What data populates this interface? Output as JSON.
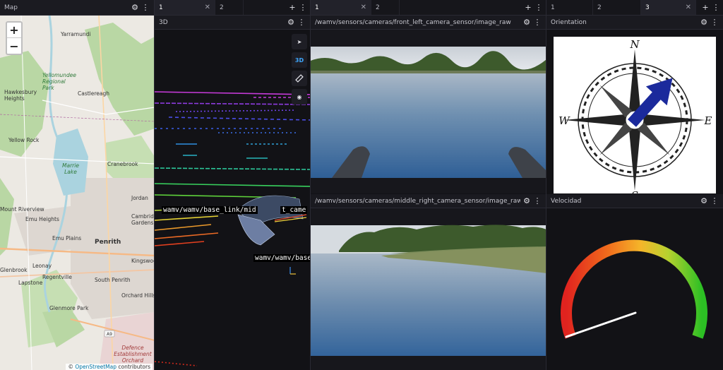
{
  "map": {
    "title": "Map",
    "zoom_in": "+",
    "zoom_out": "−",
    "places": [
      "Yarramundi",
      "Hawkesbury Heights",
      "Castlereagh",
      "Yellow Rock",
      "Cranebrook",
      "Jordan",
      "Cambridge Gardens",
      "Penrith",
      "Emu Heights",
      "Emu Plains",
      "Mount Riverview",
      "Leonay",
      "Kingswood",
      "Regentville",
      "South Penrith",
      "Lapstone",
      "Glenbrook",
      "Orchard Hills",
      "Glenmore Park"
    ],
    "green_labels": [
      "Yellomundee Regional Park",
      "Marrie Lake"
    ],
    "defence_label": "Defence Establishment Orchard",
    "road_badge": "A9",
    "attribution_symbol": "©",
    "attribution_link": "OpenStreetMap",
    "attribution_suffix": " contributors"
  },
  "viewer": {
    "tab1": "1",
    "tab2": "2",
    "close": "✕",
    "add": "+",
    "title": "3D",
    "tools": {
      "select": "➤",
      "mode": "3D",
      "measure": "📏",
      "camera": "◉"
    },
    "frame_labels": [
      "wamv/wamv/base_link/mid",
      "t_came",
      "wamv/wamv/base_"
    ]
  },
  "cameras": {
    "tab1": "1",
    "tab2": "2",
    "close": "✕",
    "add": "+",
    "front_title": "/wamv/sensors/cameras/front_left_camera_sensor/image_raw",
    "middle_title": "/wamv/sensors/cameras/middle_right_camera_sensor/image_raw"
  },
  "orientation": {
    "tab1": "1",
    "tab2": "2",
    "tab3": "3",
    "close": "✕",
    "add": "+",
    "title": "Orientation",
    "n": "N",
    "s": "S",
    "e": "E",
    "w": "W",
    "heading_deg": 42
  },
  "velocity": {
    "title": "Velocidad",
    "value_fraction": 0.04
  },
  "icons": {
    "gear": "⚙",
    "more": "⋮"
  },
  "colors": {
    "accent": "#3ea8ff",
    "panel": "#121216",
    "header": "#1b1b21"
  }
}
